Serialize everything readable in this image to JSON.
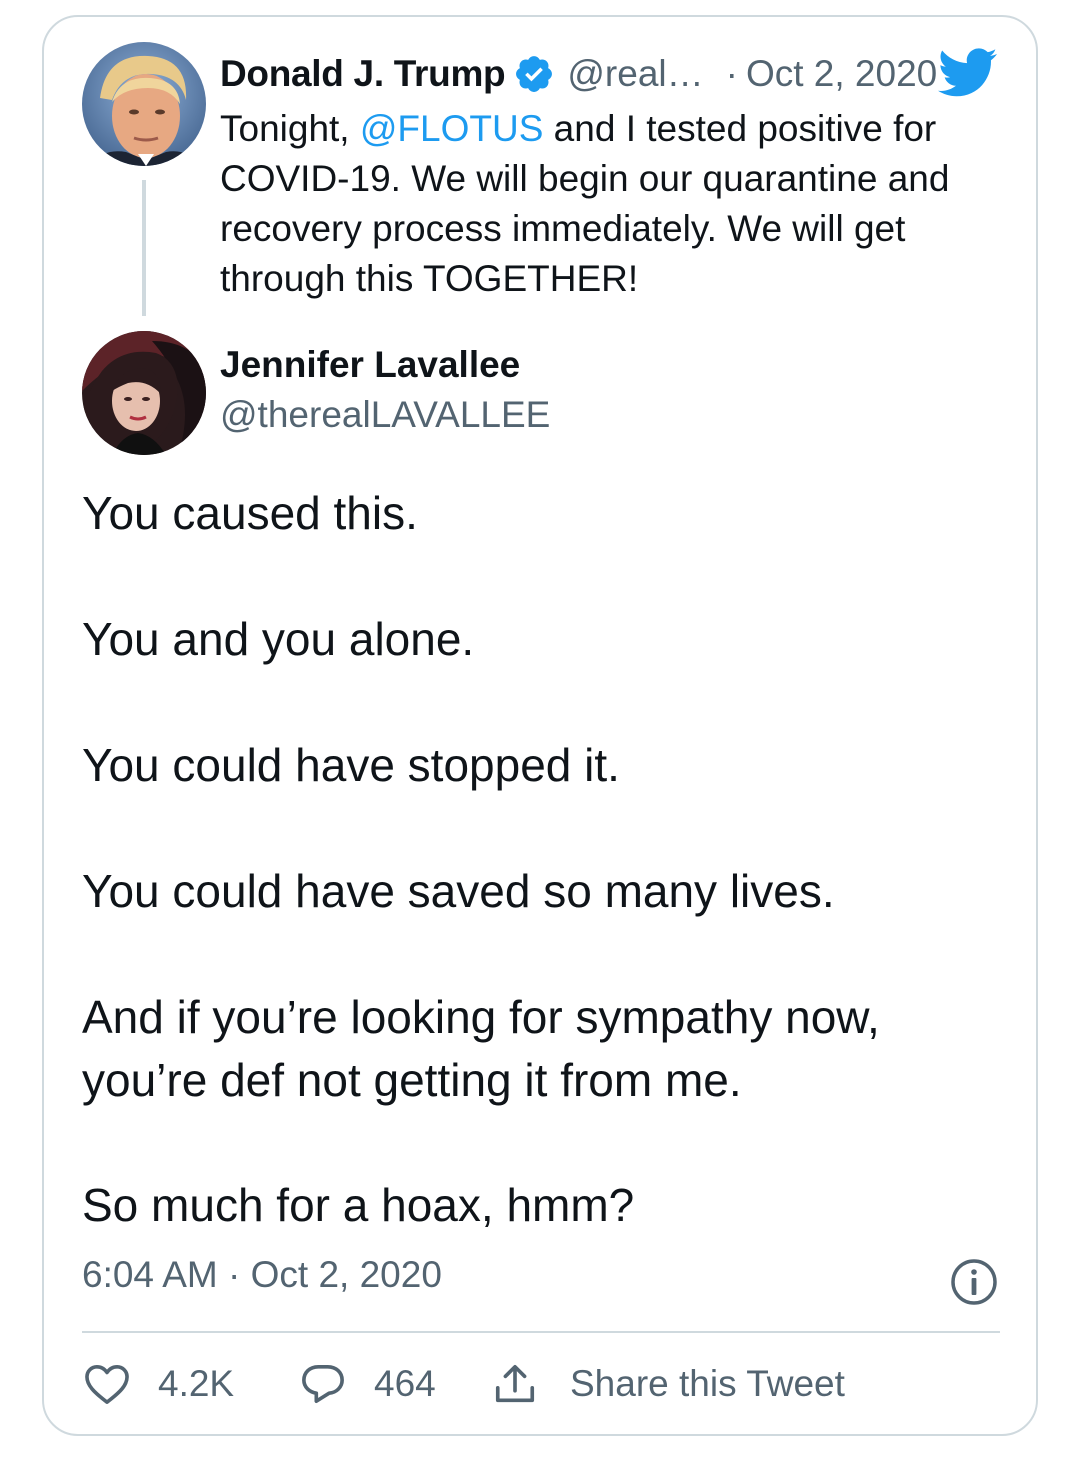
{
  "quoted_tweet": {
    "author_name": "Donald J. Trump",
    "handle": "@real…",
    "separator": "·",
    "date": "Oct 2, 2020",
    "text_before_mention": "Tonight, ",
    "mention": "@FLOTUS",
    "text_after_mention": " and I tested positive for COVID-19. We will begin our quarantine and recovery process immediately. We will get through this TOGETHER!",
    "verified": true
  },
  "reply": {
    "author_name": "Jennifer Lavallee",
    "handle": "@therealLAVALLEE",
    "lines": [
      "You caused this.",
      "You and you alone.",
      "You could have stopped it.",
      "You could have saved so many lives.",
      "And if you’re looking for sympathy now,",
      "you’re def not getting it from me.",
      "So much for a hoax, hmm?"
    ],
    "timestamp": "6:04 AM · Oct 2, 2020"
  },
  "actions": {
    "like_count": "4.2K",
    "reply_count": "464",
    "share_label": "Share this Tweet"
  },
  "colors": {
    "accent": "#1d9bf0",
    "secondary_text": "#536471",
    "border": "#cfd9de",
    "primary_text": "#0f1419"
  },
  "icons": {
    "brand": "twitter-bird-icon",
    "verified": "verified-badge-icon",
    "info": "info-icon",
    "like": "heart-icon",
    "reply": "comment-icon",
    "share": "share-icon"
  }
}
